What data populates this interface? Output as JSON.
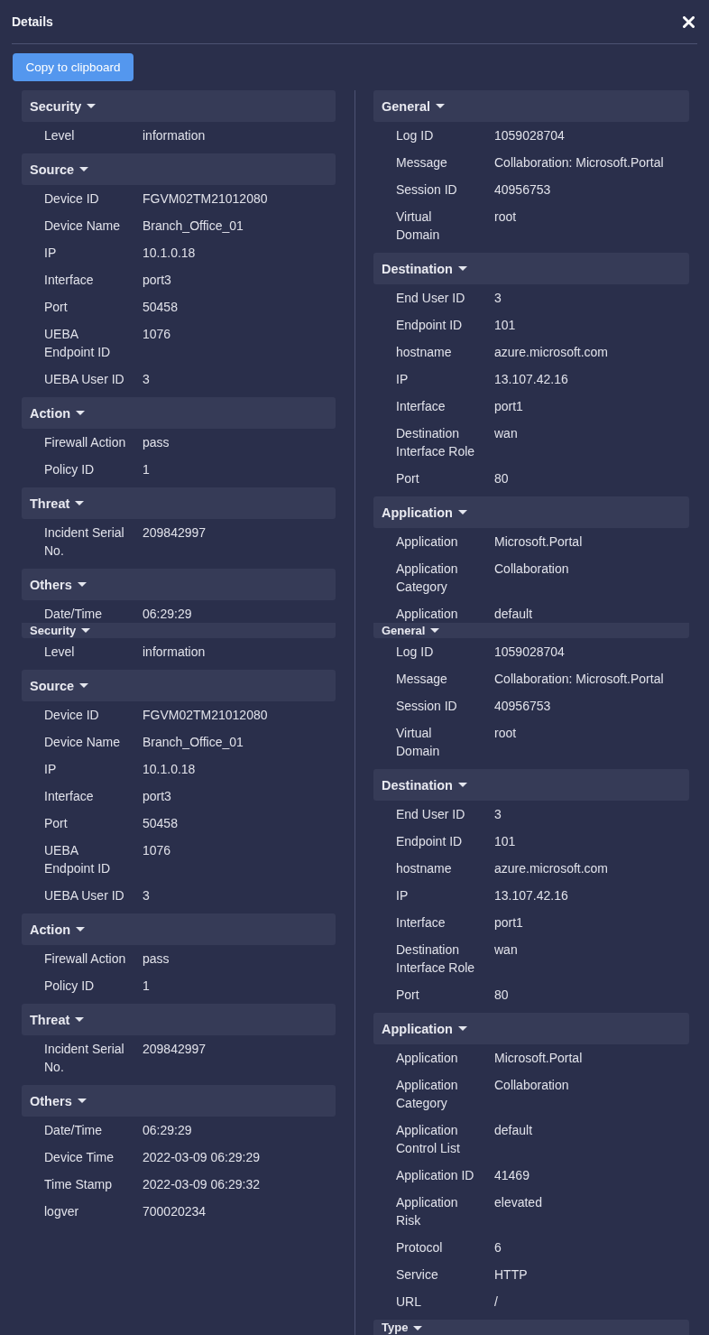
{
  "dialog": {
    "title": "Details"
  },
  "copy_button": {
    "label": "Copy to clipboard"
  },
  "views": [
    {
      "left": [
        {
          "title": "Security",
          "expanded": true,
          "rows": [
            {
              "key": "Level",
              "value": "information"
            }
          ]
        },
        {
          "title": "Source",
          "expanded": true,
          "rows": [
            {
              "key": "Device ID",
              "value": "FGVM02TM21012080"
            },
            {
              "key": "Device Name",
              "value": "Branch_Office_01"
            },
            {
              "key": "IP",
              "value": "10.1.0.18"
            },
            {
              "key": "Interface",
              "value": "port3"
            },
            {
              "key": "Port",
              "value": "50458"
            },
            {
              "key": "UEBA\nEndpoint ID",
              "value": "1076"
            },
            {
              "key": "UEBA User ID",
              "value": "3"
            }
          ]
        },
        {
          "title": "Action",
          "expanded": true,
          "rows": [
            {
              "key": "Firewall Action",
              "value": "pass"
            },
            {
              "key": "Policy ID",
              "value": "1"
            }
          ]
        },
        {
          "title": "Threat",
          "expanded": true,
          "rows": [
            {
              "key": "Incident Serial\nNo.",
              "value": "209842997"
            }
          ]
        },
        {
          "title": "Others",
          "expanded": true,
          "rows": [
            {
              "key": "Date/Time",
              "value": "06:29:29"
            }
          ]
        }
      ],
      "right": [
        {
          "title": "General",
          "expanded": true,
          "rows": [
            {
              "key": "Log ID",
              "value": "1059028704"
            },
            {
              "key": "Message",
              "value": "Collaboration: Microsoft.Portal"
            },
            {
              "key": "Session ID",
              "value": "40956753"
            },
            {
              "key": "Virtual\nDomain",
              "value": "root"
            }
          ]
        },
        {
          "title": "Destination",
          "expanded": true,
          "rows": [
            {
              "key": "End User ID",
              "value": "3"
            },
            {
              "key": "Endpoint ID",
              "value": "101"
            },
            {
              "key": "hostname",
              "value": "azure.microsoft.com"
            },
            {
              "key": "IP",
              "value": "13.107.42.16"
            },
            {
              "key": "Interface",
              "value": "port1"
            },
            {
              "key": "Destination\nInterface Role",
              "value": "wan"
            },
            {
              "key": "Port",
              "value": "80"
            }
          ]
        },
        {
          "title": "Application",
          "expanded": true,
          "rows": [
            {
              "key": "Application",
              "value": "Microsoft.Portal"
            },
            {
              "key": "Application\nCategory",
              "value": "Collaboration"
            },
            {
              "key": "Application",
              "value": "default"
            }
          ]
        }
      ]
    },
    {
      "left": [
        {
          "title": "Security",
          "expanded": true,
          "rows": [
            {
              "key": "Level",
              "value": "information"
            }
          ]
        },
        {
          "title": "Source",
          "expanded": true,
          "rows": [
            {
              "key": "Device ID",
              "value": "FGVM02TM21012080"
            },
            {
              "key": "Device Name",
              "value": "Branch_Office_01"
            },
            {
              "key": "IP",
              "value": "10.1.0.18"
            },
            {
              "key": "Interface",
              "value": "port3"
            },
            {
              "key": "Port",
              "value": "50458"
            },
            {
              "key": "UEBA\nEndpoint ID",
              "value": "1076"
            },
            {
              "key": "UEBA User ID",
              "value": "3"
            }
          ]
        },
        {
          "title": "Action",
          "expanded": true,
          "rows": [
            {
              "key": "Firewall Action",
              "value": "pass"
            },
            {
              "key": "Policy ID",
              "value": "1"
            }
          ]
        },
        {
          "title": "Threat",
          "expanded": true,
          "rows": [
            {
              "key": "Incident Serial\nNo.",
              "value": "209842997"
            }
          ]
        },
        {
          "title": "Others",
          "expanded": true,
          "rows": [
            {
              "key": "Date/Time",
              "value": "06:29:29"
            },
            {
              "key": "Device Time",
              "value": "2022-03-09 06:29:29"
            },
            {
              "key": "Time Stamp",
              "value": "2022-03-09 06:29:32"
            },
            {
              "key": "logver",
              "value": "700020234"
            }
          ]
        }
      ],
      "right": [
        {
          "title": "General",
          "expanded": true,
          "rows": [
            {
              "key": "Log ID",
              "value": "1059028704"
            },
            {
              "key": "Message",
              "value": "Collaboration: Microsoft.Portal"
            },
            {
              "key": "Session ID",
              "value": "40956753"
            },
            {
              "key": "Virtual\nDomain",
              "value": "root"
            }
          ]
        },
        {
          "title": "Destination",
          "expanded": true,
          "rows": [
            {
              "key": "End User ID",
              "value": "3"
            },
            {
              "key": "Endpoint ID",
              "value": "101"
            },
            {
              "key": "hostname",
              "value": "azure.microsoft.com"
            },
            {
              "key": "IP",
              "value": "13.107.42.16"
            },
            {
              "key": "Interface",
              "value": "port1"
            },
            {
              "key": "Destination\nInterface Role",
              "value": "wan"
            },
            {
              "key": "Port",
              "value": "80"
            }
          ]
        },
        {
          "title": "Application",
          "expanded": true,
          "rows": [
            {
              "key": "Application",
              "value": "Microsoft.Portal"
            },
            {
              "key": "Application\nCategory",
              "value": "Collaboration"
            },
            {
              "key": "Application\nControl List",
              "value": "default"
            },
            {
              "key": "Application ID",
              "value": "41469"
            },
            {
              "key": "Application\nRisk",
              "value": "elevated"
            },
            {
              "key": "Protocol",
              "value": "6"
            },
            {
              "key": "Service",
              "value": "HTTP"
            },
            {
              "key": "URL",
              "value": "/"
            }
          ]
        },
        {
          "title": "Type",
          "expanded": true
        }
      ]
    }
  ]
}
